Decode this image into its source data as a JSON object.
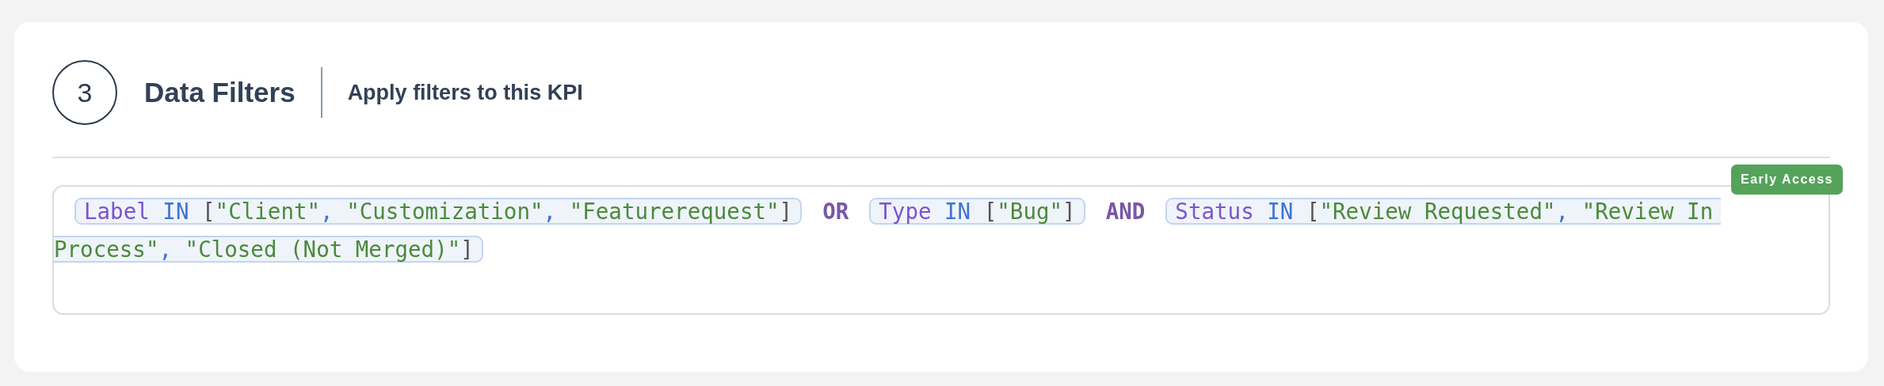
{
  "step": {
    "number": "3",
    "title": "Data Filters",
    "subtitle": "Apply filters to this KPI"
  },
  "badge": "Early Access",
  "filters": [
    {
      "kind": "clause",
      "segments": [
        [
          {
            "kind": "field",
            "text": "Label"
          },
          {
            "kind": "operator",
            "text": "IN"
          },
          {
            "kind": "punct",
            "text": "["
          },
          {
            "kind": "string",
            "text": "\"Client\""
          },
          {
            "kind": "sep",
            "text": ","
          },
          {
            "kind": "string",
            "text": "\"Customization\""
          },
          {
            "kind": "sep",
            "text": ","
          },
          {
            "kind": "string",
            "text": "\"Featurerequest\""
          },
          {
            "kind": "punct",
            "text": "]"
          }
        ]
      ]
    },
    {
      "kind": "connector",
      "text": "OR"
    },
    {
      "kind": "clause",
      "segments": [
        [
          {
            "kind": "field",
            "text": "Type"
          },
          {
            "kind": "operator",
            "text": "IN"
          },
          {
            "kind": "punct",
            "text": "["
          },
          {
            "kind": "string",
            "text": "\"Bug\""
          },
          {
            "kind": "punct",
            "text": "]"
          }
        ]
      ]
    },
    {
      "kind": "connector",
      "text": "AND"
    },
    {
      "kind": "clause",
      "segments": [
        [
          {
            "kind": "field",
            "text": "Status"
          },
          {
            "kind": "operator",
            "text": "IN"
          },
          {
            "kind": "punct",
            "text": "["
          },
          {
            "kind": "string",
            "text": "\"Review Requested\""
          },
          {
            "kind": "sep",
            "text": ","
          },
          {
            "kind": "string",
            "text": "\"Review In"
          }
        ],
        [
          {
            "kind": "string",
            "text": "Process\""
          },
          {
            "kind": "sep",
            "text": ","
          },
          {
            "kind": "string",
            "text": "\"Closed (Not Merged)\""
          },
          {
            "kind": "punct",
            "text": "]"
          }
        ]
      ]
    }
  ]
}
